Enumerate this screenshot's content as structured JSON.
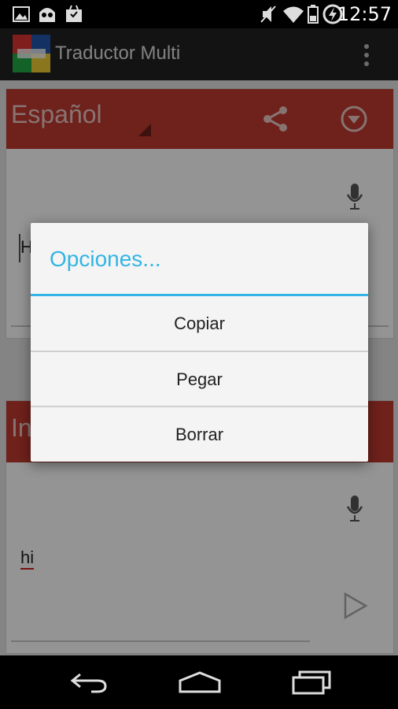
{
  "status_bar": {
    "time": "12:57"
  },
  "app_bar": {
    "title": "Traductor Multi"
  },
  "source": {
    "language": "Español",
    "text_visible": "H"
  },
  "target": {
    "language_visible": "In",
    "text": "hi"
  },
  "dialog": {
    "title": "Opciones...",
    "options": [
      "Copiar",
      "Pegar",
      "Borrar"
    ]
  },
  "colors": {
    "accent": "#33b5e5",
    "language_bar": "#bf3a30",
    "underline": "#cc2222"
  }
}
